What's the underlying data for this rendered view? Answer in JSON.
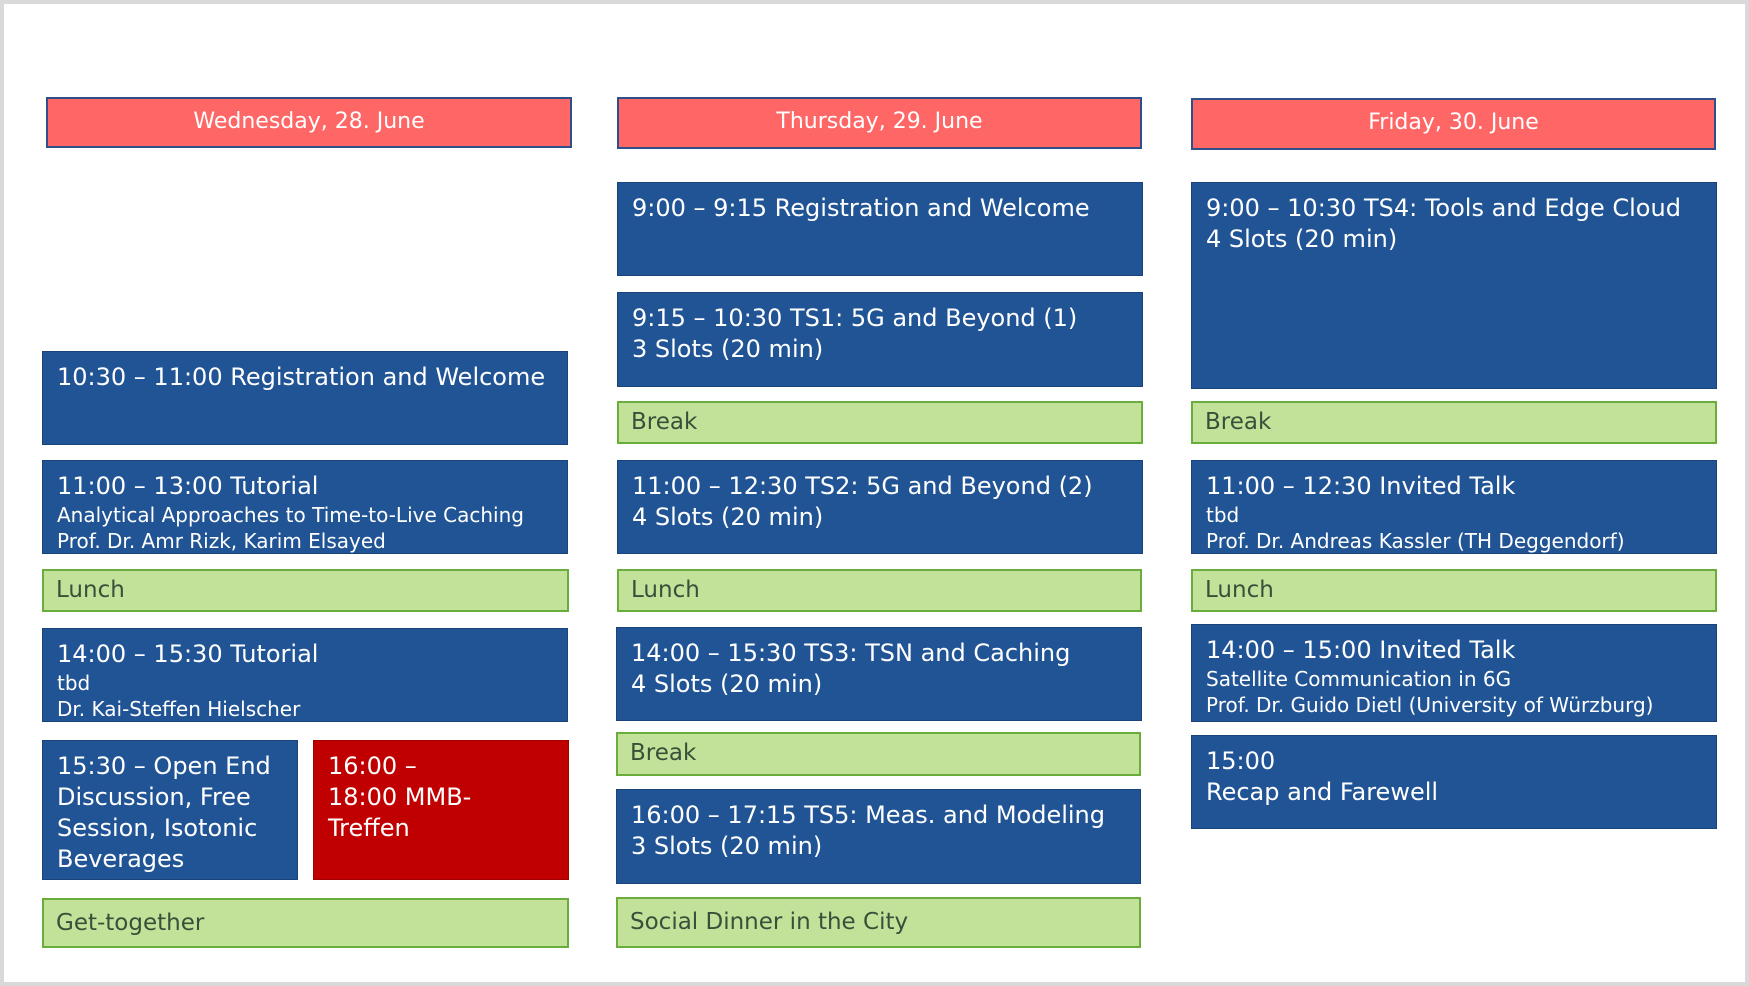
{
  "days": [
    {
      "title": "Wednesday, 28. June",
      "sessions": [
        {
          "main": "10:30 – 11:00 Registration and Welcome"
        },
        {
          "main": "11:00 – 13:00 Tutorial",
          "sub1": "Analytical Approaches to Time-to-Live Caching",
          "sub2": "Prof. Dr. Amr Rizk, Karim Elsayed"
        },
        {
          "main": "Lunch"
        },
        {
          "main": "14:00 – 15:30 Tutorial",
          "sub1": "tbd",
          "sub2": "Dr. Kai-Steffen Hielscher"
        },
        {
          "main": "15:30 – Open End Discussion, Free Session, Isotonic Beverages"
        },
        {
          "main": "16:00 – 18:00 MMB-Treffen"
        },
        {
          "main": "Get-together"
        }
      ]
    },
    {
      "title": "Thursday, 29. June",
      "sessions": [
        {
          "main": "9:00 – 9:15 Registration and Welcome"
        },
        {
          "main": "9:15 – 10:30 TS1: 5G and Beyond (1)",
          "sub1": "3 Slots (20 min)"
        },
        {
          "main": "Break"
        },
        {
          "main": "11:00 – 12:30 TS2: 5G and Beyond (2)",
          "sub1": "4 Slots (20 min)"
        },
        {
          "main": "Lunch"
        },
        {
          "main": "14:00 – 15:30 TS3: TSN and Caching",
          "sub1": "4 Slots (20 min)"
        },
        {
          "main": "Break"
        },
        {
          "main": "16:00 – 17:15 TS5: Meas. and Modeling",
          "sub1": "3 Slots (20 min)"
        },
        {
          "main": "Social Dinner in the City"
        }
      ]
    },
    {
      "title": "Friday, 30. June",
      "sessions": [
        {
          "main": "9:00 – 10:30 TS4: Tools and Edge Cloud",
          "sub1": "4 Slots (20 min)"
        },
        {
          "main": "Break"
        },
        {
          "main": "11:00 – 12:30 Invited Talk",
          "sub1": "tbd",
          "sub2": "Prof. Dr. Andreas Kassler (TH Deggendorf)"
        },
        {
          "main": "Lunch"
        },
        {
          "main": "14:00 – 15:00 Invited Talk",
          "sub1": "Satellite Communication in 6G",
          "sub2": "Prof. Dr. Guido Dietl (University of Würzburg)"
        },
        {
          "main": "15:00",
          "sub1": "Recap and Farewell"
        }
      ]
    }
  ],
  "colors": {
    "day_header": "#ff6666",
    "session": "#215495",
    "break": "#c2e29a",
    "highlight": "#c00000"
  }
}
